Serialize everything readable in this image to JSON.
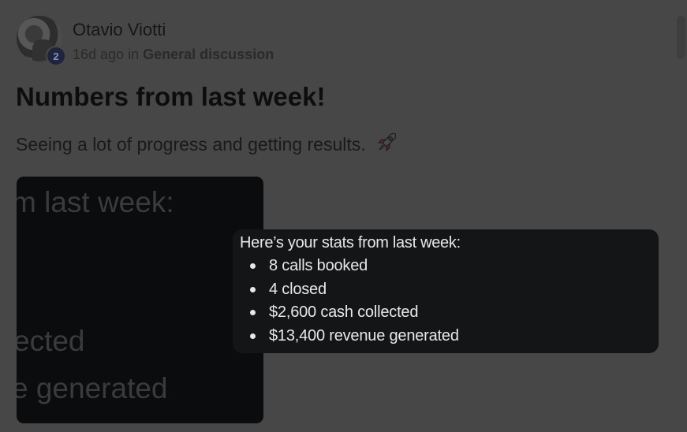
{
  "post": {
    "author": "Otavio Viotti",
    "level": "2",
    "time_ago": "16d ago",
    "in_word": "in",
    "category": "General discussion",
    "title": "Numbers from last week!",
    "body": "Seeing a lot of progress and getting results.",
    "body_emoji_icon": "rocket-icon"
  },
  "attachment_preview": {
    "lines": [
      "m last week:",
      "ected",
      "e generated"
    ]
  },
  "stats_popup": {
    "heading": "Here’s your stats from last week:",
    "items": [
      "8 calls booked",
      "4 closed",
      "$2,600 cash collected",
      "$13,400 revenue generated"
    ]
  },
  "colors": {
    "overlay_background": "#474747",
    "popup_background": "#141517",
    "badge_background": "#20253f"
  }
}
